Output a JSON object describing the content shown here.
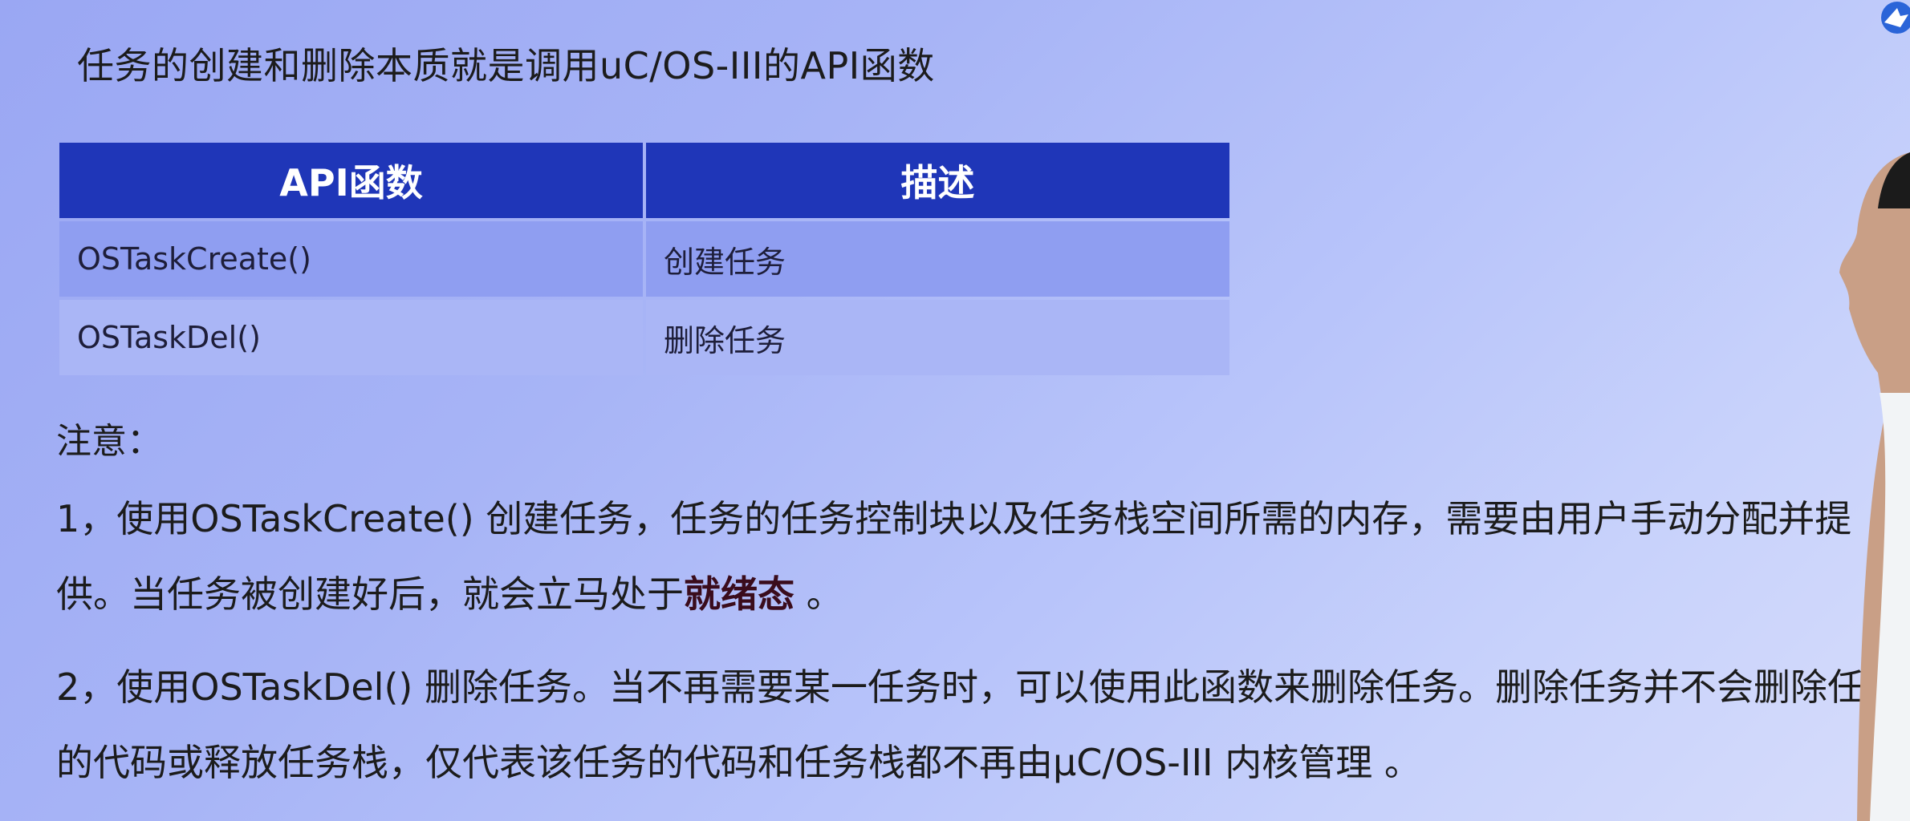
{
  "heading": "任务的创建和删除本质就是调用uC/OS-III的API函数",
  "table": {
    "headers": [
      "API函数",
      "描述"
    ],
    "rows": [
      [
        "OSTaskCreate()",
        "创建任务"
      ],
      [
        "OSTaskDel()",
        "删除任务"
      ]
    ]
  },
  "notes": {
    "title": "注意：",
    "p1": {
      "before": "1，使用OSTaskCreate() 创建任务，任务的任务控制块以及任务栈空间所需的内存，需要由用户手动分配并提供。当任务被创建好后，就会立马处于",
      "highlight": "就绪态",
      "after": " 。"
    },
    "p2": "2，使用OSTaskDel() 删除任务。当不再需要某一任务时，可以使用此函数来删除任务。删除任务并不会删除任务的代码或释放任务栈，仅代表该任务的代码和任务栈都不再由μC/OS-III 内核管理 。"
  },
  "colors": {
    "header_bg": "#1f36b8",
    "row_a": "#8f9ef1",
    "row_b": "#aab6f6",
    "highlight": "#3a0c1c"
  },
  "icons": [
    "bird-logo-icon"
  ]
}
